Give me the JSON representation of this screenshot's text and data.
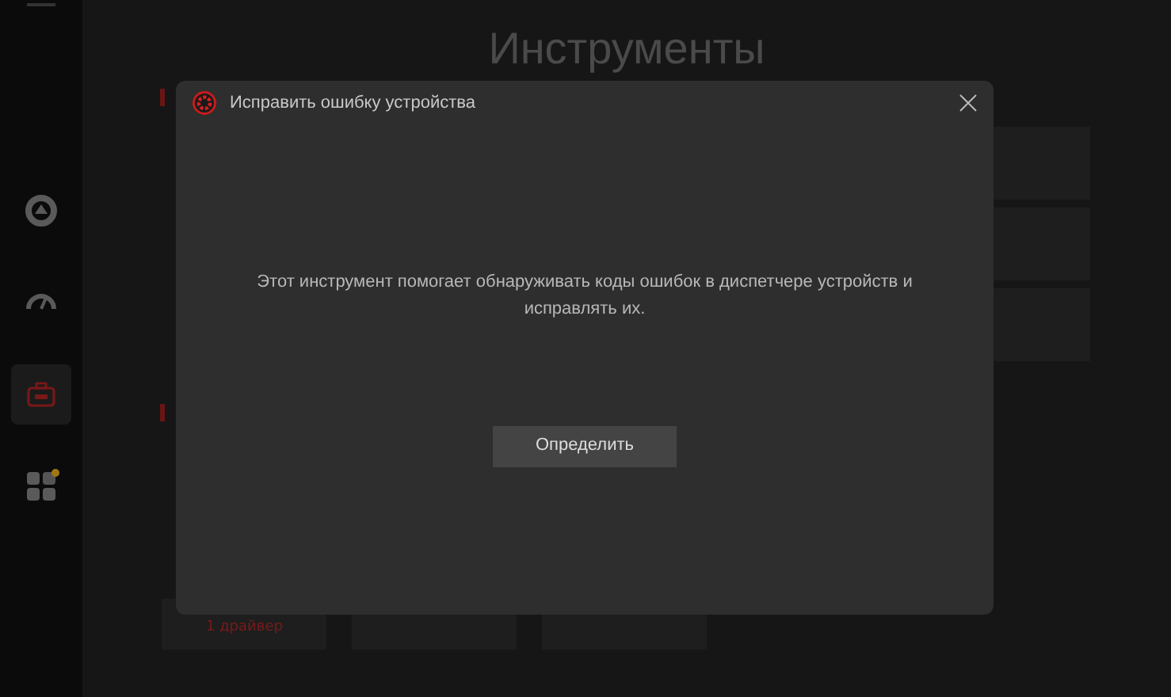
{
  "sidebar": {
    "items": [
      {
        "kind": "cleanup",
        "selected": false,
        "badge": false
      },
      {
        "kind": "speed",
        "selected": false,
        "badge": false
      },
      {
        "kind": "toolbox",
        "selected": true,
        "badge": false
      },
      {
        "kind": "apps",
        "selected": false,
        "badge": true
      }
    ]
  },
  "page_title": "Инструменты",
  "background_card": {
    "subtitle": "1 драйвер"
  },
  "dialog": {
    "title": "Исправить ошибку устройства",
    "message": "Этот инструмент помогает обнаруживать коды ошибок в диспетчере устройств и исправлять их.",
    "button": "Определить"
  }
}
